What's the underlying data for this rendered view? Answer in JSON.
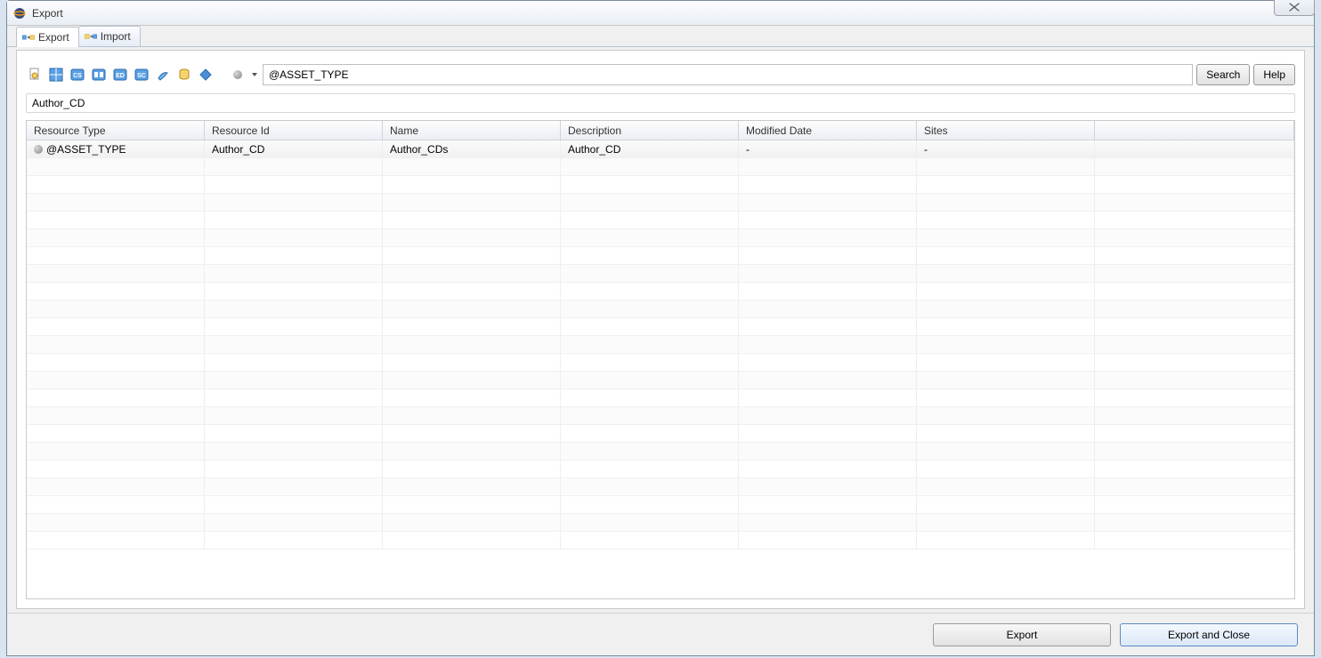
{
  "window": {
    "title": "Export"
  },
  "tabs": [
    {
      "label": "Export"
    },
    {
      "label": "Import"
    }
  ],
  "search": {
    "value": "@ASSET_TYPE",
    "search_btn": "Search",
    "help_btn": "Help"
  },
  "breadcrumb": "Author_CD",
  "columns": [
    "Resource Type",
    "Resource Id",
    "Name",
    "Description",
    "Modified Date",
    "Sites"
  ],
  "rows": [
    {
      "resource_type": "@ASSET_TYPE",
      "resource_id": "Author_CD",
      "name": "Author_CDs",
      "description": "Author_CD",
      "modified_date": "-",
      "sites": "-"
    }
  ],
  "footer": {
    "export_btn": "Export",
    "export_close_btn": "Export and Close"
  }
}
